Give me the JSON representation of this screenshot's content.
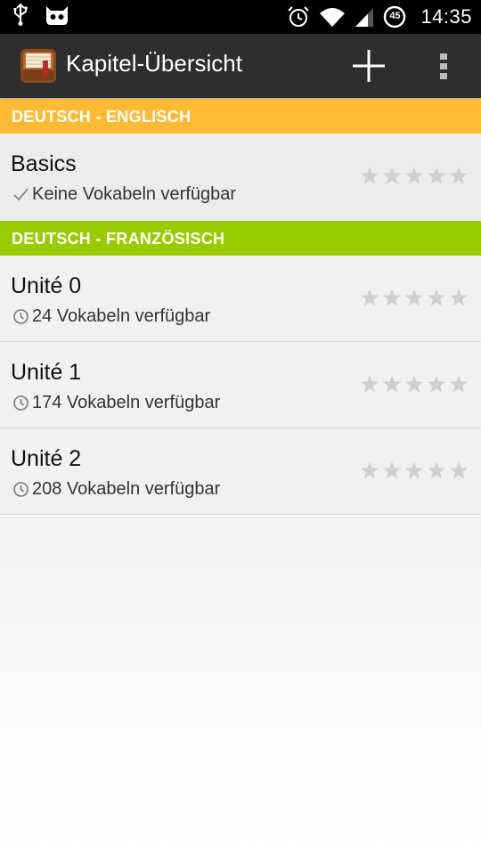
{
  "status_bar": {
    "time": "14:35",
    "battery_level": "45",
    "icons": [
      "usb-icon",
      "cyanogen-icon",
      "alarm-icon",
      "wifi-icon",
      "signal-icon",
      "battery-icon"
    ]
  },
  "action_bar": {
    "title": "Kapitel-Übersicht",
    "icons": [
      "app-icon",
      "add-icon",
      "overflow-menu-icon"
    ]
  },
  "sections": [
    {
      "header": "DEUTSCH - ENGLISCH",
      "color": "#ffba33",
      "items": [
        {
          "title": "Basics",
          "status_icon": "check-icon",
          "subtitle": "Keine Vokabeln verfügbar",
          "stars": 0
        }
      ]
    },
    {
      "header": "DEUTSCH - FRANZÖSISCH",
      "color": "#99cc00",
      "items": [
        {
          "title": "Unité 0",
          "status_icon": "clock-icon",
          "subtitle": "24 Vokabeln verfügbar",
          "stars": 0
        },
        {
          "title": "Unité 1",
          "status_icon": "clock-icon",
          "subtitle": "174 Vokabeln verfügbar",
          "stars": 0
        },
        {
          "title": "Unité 2",
          "status_icon": "clock-icon",
          "subtitle": "208 Vokabeln verfügbar",
          "stars": 0
        }
      ]
    }
  ],
  "star_color": "#cfcfcf"
}
